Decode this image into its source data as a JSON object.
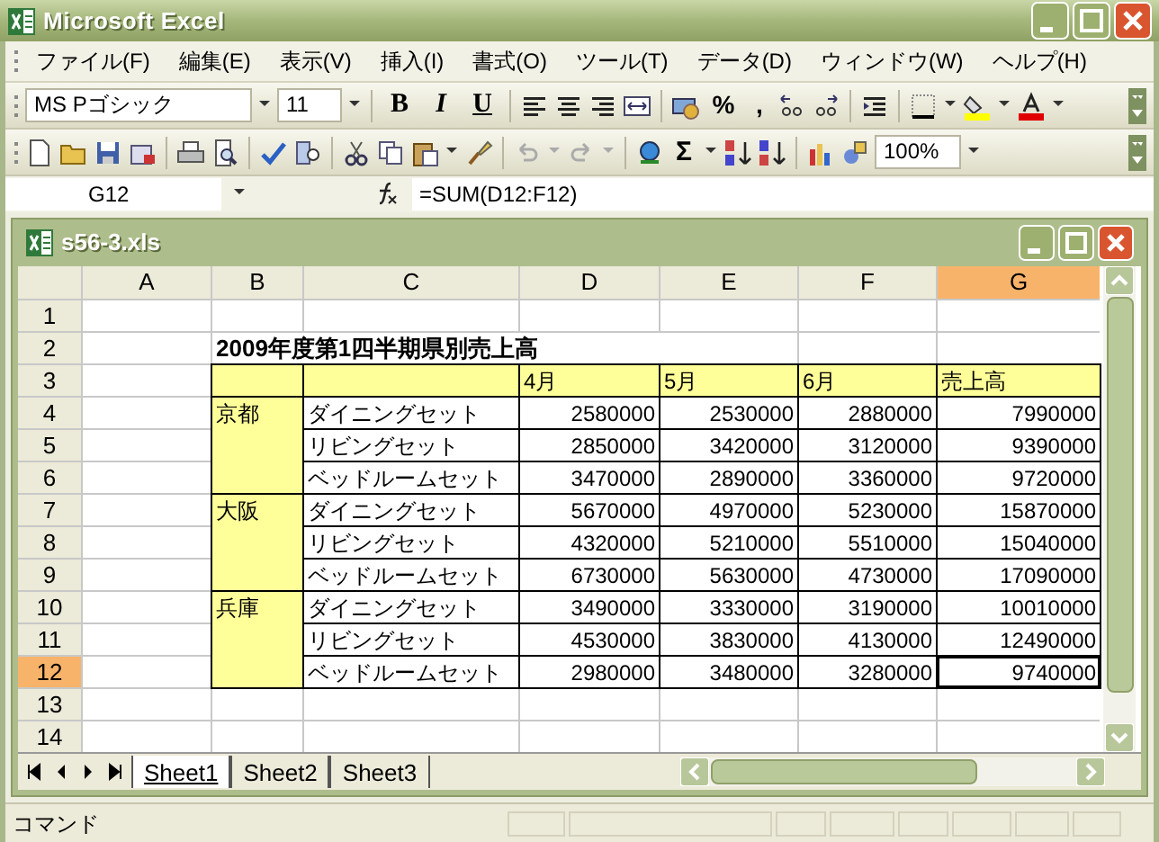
{
  "window": {
    "title": "Microsoft Excel"
  },
  "menu": [
    {
      "label": "ファイル(F)"
    },
    {
      "label": "編集(E)"
    },
    {
      "label": "表示(V)"
    },
    {
      "label": "挿入(I)"
    },
    {
      "label": "書式(O)"
    },
    {
      "label": "ツール(T)"
    },
    {
      "label": "データ(D)"
    },
    {
      "label": "ウィンドウ(W)"
    },
    {
      "label": "ヘルプ(H)"
    }
  ],
  "formatting_toolbar": {
    "font": "MS Pゴシック",
    "size": "11",
    "bold": "B",
    "italic": "I",
    "underline": "U",
    "percent": "%",
    "comma": ","
  },
  "standard_toolbar": {
    "autosum": "Σ",
    "zoom": "100%"
  },
  "formula_bar": {
    "name_box": "G12",
    "formula": "=SUM(D12:F12)"
  },
  "workbook": {
    "title": "s56-3.xls",
    "columns": [
      {
        "label": "A",
        "selected": false
      },
      {
        "label": "B",
        "selected": false
      },
      {
        "label": "C",
        "selected": false
      },
      {
        "label": "D",
        "selected": false
      },
      {
        "label": "E",
        "selected": false
      },
      {
        "label": "F",
        "selected": false
      },
      {
        "label": "G",
        "selected": true
      }
    ],
    "row_headers": [
      {
        "label": "1",
        "selected": false
      },
      {
        "label": "2",
        "selected": false
      },
      {
        "label": "3",
        "selected": false
      },
      {
        "label": "4",
        "selected": false
      },
      {
        "label": "5",
        "selected": false
      },
      {
        "label": "6",
        "selected": false
      },
      {
        "label": "7",
        "selected": false
      },
      {
        "label": "8",
        "selected": false
      },
      {
        "label": "9",
        "selected": false
      },
      {
        "label": "10",
        "selected": false
      },
      {
        "label": "11",
        "selected": false
      },
      {
        "label": "12",
        "selected": true
      },
      {
        "label": "13",
        "selected": false
      },
      {
        "label": "14",
        "selected": false
      }
    ],
    "table_title": "2009年度第1四半期県別売上高",
    "header": [
      "4月",
      "5月",
      "6月",
      "売上高"
    ],
    "groups": [
      {
        "region": "京都",
        "items": [
          {
            "product": "ダイニングセット",
            "values": [
              "2580000",
              "2530000",
              "2880000",
              "7990000"
            ],
            "total_selected": false
          },
          {
            "product": "リビングセット",
            "values": [
              "2850000",
              "3420000",
              "3120000",
              "9390000"
            ],
            "total_selected": false
          },
          {
            "product": "ベッドルームセット",
            "values": [
              "3470000",
              "2890000",
              "3360000",
              "9720000"
            ],
            "total_selected": false
          }
        ]
      },
      {
        "region": "大阪",
        "items": [
          {
            "product": "ダイニングセット",
            "values": [
              "5670000",
              "4970000",
              "5230000",
              "15870000"
            ],
            "total_selected": false
          },
          {
            "product": "リビングセット",
            "values": [
              "4320000",
              "5210000",
              "5510000",
              "15040000"
            ],
            "total_selected": false
          },
          {
            "product": "ベッドルームセット",
            "values": [
              "6730000",
              "5630000",
              "4730000",
              "17090000"
            ],
            "total_selected": false
          }
        ]
      },
      {
        "region": "兵庫",
        "items": [
          {
            "product": "ダイニングセット",
            "values": [
              "3490000",
              "3330000",
              "3190000",
              "10010000"
            ],
            "total_selected": false
          },
          {
            "product": "リビングセット",
            "values": [
              "4530000",
              "3830000",
              "4130000",
              "12490000"
            ],
            "total_selected": false
          },
          {
            "product": "ベッドルームセット",
            "values": [
              "2980000",
              "3480000",
              "3280000",
              "9740000"
            ],
            "total_selected": true
          }
        ]
      }
    ],
    "sheet_tabs": [
      {
        "label": "Sheet1",
        "selected": true
      },
      {
        "label": "Sheet2",
        "selected": false
      },
      {
        "label": "Sheet3",
        "selected": false
      }
    ]
  },
  "status_bar": {
    "text": "コマンド"
  }
}
